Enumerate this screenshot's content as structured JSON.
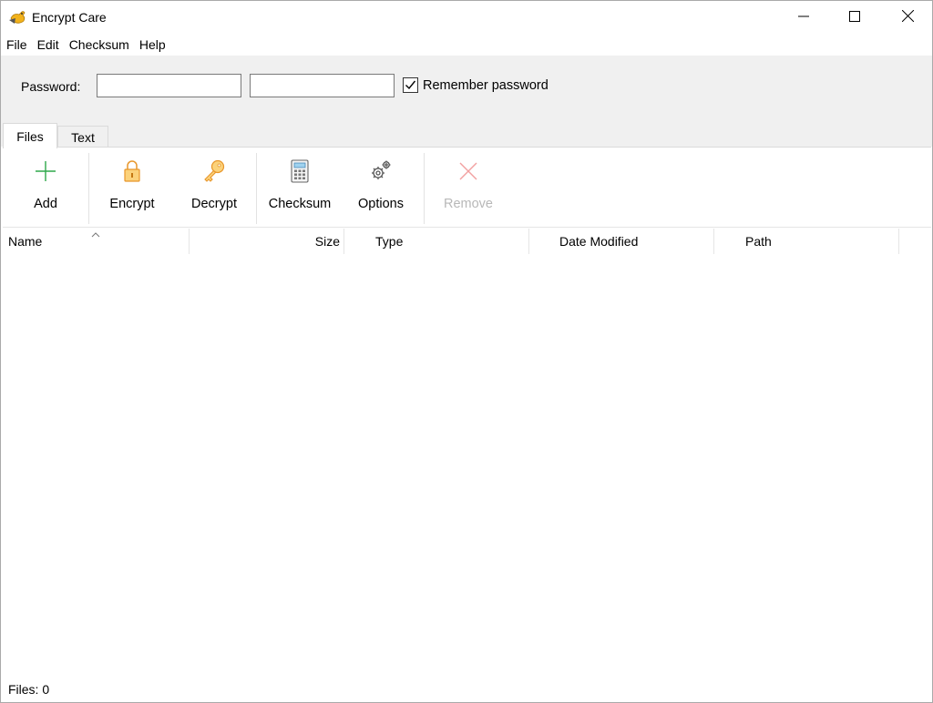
{
  "window": {
    "title": "Encrypt Care",
    "minimize_icon": "minimize-icon",
    "maximize_icon": "maximize-icon",
    "close_icon": "close-icon"
  },
  "menu": {
    "items": [
      "File",
      "Edit",
      "Checksum",
      "Help"
    ]
  },
  "password_panel": {
    "label": "Password:",
    "password_value": "",
    "confirm_value": "",
    "remember_label": "Remember password",
    "remember_checked": true
  },
  "tabs": [
    {
      "label": "Files",
      "active": true
    },
    {
      "label": "Text",
      "active": false
    }
  ],
  "toolbar": {
    "add_label": "Add",
    "encrypt_label": "Encrypt",
    "decrypt_label": "Decrypt",
    "checksum_label": "Checksum",
    "options_label": "Options",
    "remove_label": "Remove",
    "remove_enabled": false,
    "icons": {
      "add": "plus-icon",
      "encrypt": "lock-icon",
      "decrypt": "key-icon",
      "checksum": "calculator-icon",
      "options": "gears-icon",
      "remove": "x-icon"
    },
    "colors": {
      "add": "#2ea84a",
      "encrypt": "#f0a030",
      "decrypt": "#f0a030",
      "remove": "#f2a0a0"
    }
  },
  "file_list": {
    "columns": [
      "Name",
      "Size",
      "Type",
      "Date Modified",
      "Path"
    ],
    "sort_column": "Name",
    "rows": []
  },
  "status": {
    "text": "Files: 0"
  }
}
